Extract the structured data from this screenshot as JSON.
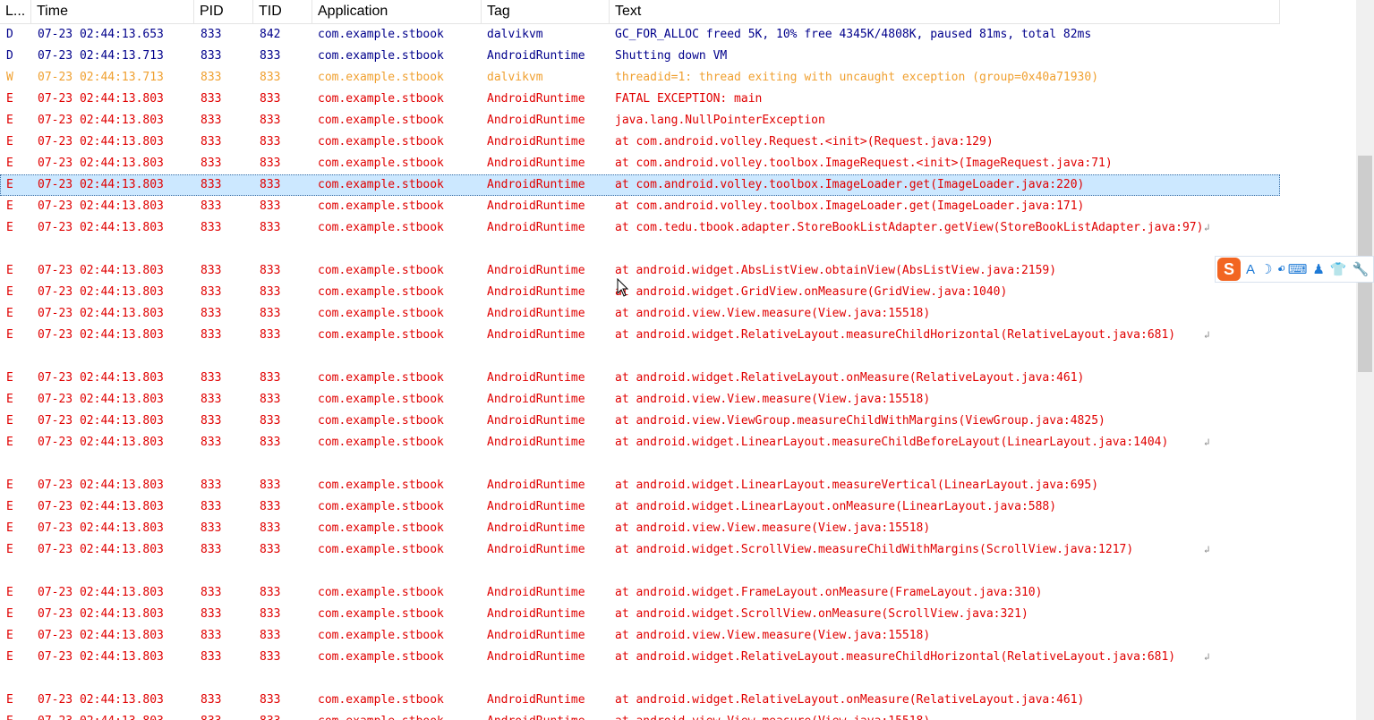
{
  "columns": [
    "L...",
    "Time",
    "PID",
    "TID",
    "Application",
    "Tag",
    "Text"
  ],
  "level_colors": {
    "D": "#00008b",
    "W": "#f0a030",
    "E": "#e00000"
  },
  "selected_row": 7,
  "scrollbar": {
    "position_fraction": 0.27,
    "visible_fraction": 0.3
  },
  "ime_toolbar": {
    "logo": "S",
    "buttons": [
      "A",
      "☽",
      "•ͦ",
      "⌨",
      "♟",
      "👕",
      "🔧"
    ],
    "icons": [
      "sogou-logo-icon",
      "font-a-icon",
      "moon-icon",
      "punctuation-icon",
      "keyboard-icon",
      "user-icon",
      "skin-icon",
      "tools-icon"
    ]
  },
  "rows": [
    {
      "level": "D",
      "time": "07-23 02:44:13.653",
      "pid": "833",
      "tid": "842",
      "app": "com.example.stbook",
      "tag": "dalvikvm",
      "text": "GC_FOR_ALLOC freed 5K, 10% free 4345K/4808K, paused 81ms, total 82ms",
      "wrap": false
    },
    {
      "level": "D",
      "time": "07-23 02:44:13.713",
      "pid": "833",
      "tid": "833",
      "app": "com.example.stbook",
      "tag": "AndroidRuntime",
      "text": "Shutting down VM",
      "wrap": false
    },
    {
      "level": "W",
      "time": "07-23 02:44:13.713",
      "pid": "833",
      "tid": "833",
      "app": "com.example.stbook",
      "tag": "dalvikvm",
      "text": "threadid=1: thread exiting with uncaught exception (group=0x40a71930)",
      "wrap": false
    },
    {
      "level": "E",
      "time": "07-23 02:44:13.803",
      "pid": "833",
      "tid": "833",
      "app": "com.example.stbook",
      "tag": "AndroidRuntime",
      "text": "FATAL EXCEPTION: main",
      "wrap": false
    },
    {
      "level": "E",
      "time": "07-23 02:44:13.803",
      "pid": "833",
      "tid": "833",
      "app": "com.example.stbook",
      "tag": "AndroidRuntime",
      "text": "java.lang.NullPointerException",
      "wrap": false
    },
    {
      "level": "E",
      "time": "07-23 02:44:13.803",
      "pid": "833",
      "tid": "833",
      "app": "com.example.stbook",
      "tag": "AndroidRuntime",
      "text": "at com.android.volley.Request.<init>(Request.java:129)",
      "wrap": false
    },
    {
      "level": "E",
      "time": "07-23 02:44:13.803",
      "pid": "833",
      "tid": "833",
      "app": "com.example.stbook",
      "tag": "AndroidRuntime",
      "text": "at com.android.volley.toolbox.ImageRequest.<init>(ImageRequest.java:71)",
      "wrap": false
    },
    {
      "level": "E",
      "time": "07-23 02:44:13.803",
      "pid": "833",
      "tid": "833",
      "app": "com.example.stbook",
      "tag": "AndroidRuntime",
      "text": "at com.android.volley.toolbox.ImageLoader.get(ImageLoader.java:220)",
      "wrap": false
    },
    {
      "level": "E",
      "time": "07-23 02:44:13.803",
      "pid": "833",
      "tid": "833",
      "app": "com.example.stbook",
      "tag": "AndroidRuntime",
      "text": "at com.android.volley.toolbox.ImageLoader.get(ImageLoader.java:171)",
      "wrap": false
    },
    {
      "level": "E",
      "time": "07-23 02:44:13.803",
      "pid": "833",
      "tid": "833",
      "app": "com.example.stbook",
      "tag": "AndroidRuntime",
      "text": "at com.tedu.tbook.adapter.StoreBookListAdapter.getView(StoreBookListAdapter.java:97)",
      "wrap": true
    },
    {
      "level": "E",
      "time": "07-23 02:44:13.803",
      "pid": "833",
      "tid": "833",
      "app": "com.example.stbook",
      "tag": "AndroidRuntime",
      "text": "at android.widget.AbsListView.obtainView(AbsListView.java:2159)",
      "wrap": false
    },
    {
      "level": "E",
      "time": "07-23 02:44:13.803",
      "pid": "833",
      "tid": "833",
      "app": "com.example.stbook",
      "tag": "AndroidRuntime",
      "text": "at android.widget.GridView.onMeasure(GridView.java:1040)",
      "wrap": false
    },
    {
      "level": "E",
      "time": "07-23 02:44:13.803",
      "pid": "833",
      "tid": "833",
      "app": "com.example.stbook",
      "tag": "AndroidRuntime",
      "text": "at android.view.View.measure(View.java:15518)",
      "wrap": false
    },
    {
      "level": "E",
      "time": "07-23 02:44:13.803",
      "pid": "833",
      "tid": "833",
      "app": "com.example.stbook",
      "tag": "AndroidRuntime",
      "text": "at android.widget.RelativeLayout.measureChildHorizontal(RelativeLayout.java:681)",
      "wrap": true
    },
    {
      "level": "E",
      "time": "07-23 02:44:13.803",
      "pid": "833",
      "tid": "833",
      "app": "com.example.stbook",
      "tag": "AndroidRuntime",
      "text": "at android.widget.RelativeLayout.onMeasure(RelativeLayout.java:461)",
      "wrap": false
    },
    {
      "level": "E",
      "time": "07-23 02:44:13.803",
      "pid": "833",
      "tid": "833",
      "app": "com.example.stbook",
      "tag": "AndroidRuntime",
      "text": "at android.view.View.measure(View.java:15518)",
      "wrap": false
    },
    {
      "level": "E",
      "time": "07-23 02:44:13.803",
      "pid": "833",
      "tid": "833",
      "app": "com.example.stbook",
      "tag": "AndroidRuntime",
      "text": "at android.view.ViewGroup.measureChildWithMargins(ViewGroup.java:4825)",
      "wrap": false
    },
    {
      "level": "E",
      "time": "07-23 02:44:13.803",
      "pid": "833",
      "tid": "833",
      "app": "com.example.stbook",
      "tag": "AndroidRuntime",
      "text": "at android.widget.LinearLayout.measureChildBeforeLayout(LinearLayout.java:1404)",
      "wrap": true
    },
    {
      "level": "E",
      "time": "07-23 02:44:13.803",
      "pid": "833",
      "tid": "833",
      "app": "com.example.stbook",
      "tag": "AndroidRuntime",
      "text": "at android.widget.LinearLayout.measureVertical(LinearLayout.java:695)",
      "wrap": false
    },
    {
      "level": "E",
      "time": "07-23 02:44:13.803",
      "pid": "833",
      "tid": "833",
      "app": "com.example.stbook",
      "tag": "AndroidRuntime",
      "text": "at android.widget.LinearLayout.onMeasure(LinearLayout.java:588)",
      "wrap": false
    },
    {
      "level": "E",
      "time": "07-23 02:44:13.803",
      "pid": "833",
      "tid": "833",
      "app": "com.example.stbook",
      "tag": "AndroidRuntime",
      "text": "at android.view.View.measure(View.java:15518)",
      "wrap": false
    },
    {
      "level": "E",
      "time": "07-23 02:44:13.803",
      "pid": "833",
      "tid": "833",
      "app": "com.example.stbook",
      "tag": "AndroidRuntime",
      "text": "at android.widget.ScrollView.measureChildWithMargins(ScrollView.java:1217)",
      "wrap": true
    },
    {
      "level": "E",
      "time": "07-23 02:44:13.803",
      "pid": "833",
      "tid": "833",
      "app": "com.example.stbook",
      "tag": "AndroidRuntime",
      "text": "at android.widget.FrameLayout.onMeasure(FrameLayout.java:310)",
      "wrap": false
    },
    {
      "level": "E",
      "time": "07-23 02:44:13.803",
      "pid": "833",
      "tid": "833",
      "app": "com.example.stbook",
      "tag": "AndroidRuntime",
      "text": "at android.widget.ScrollView.onMeasure(ScrollView.java:321)",
      "wrap": false
    },
    {
      "level": "E",
      "time": "07-23 02:44:13.803",
      "pid": "833",
      "tid": "833",
      "app": "com.example.stbook",
      "tag": "AndroidRuntime",
      "text": "at android.view.View.measure(View.java:15518)",
      "wrap": false
    },
    {
      "level": "E",
      "time": "07-23 02:44:13.803",
      "pid": "833",
      "tid": "833",
      "app": "com.example.stbook",
      "tag": "AndroidRuntime",
      "text": "at android.widget.RelativeLayout.measureChildHorizontal(RelativeLayout.java:681)",
      "wrap": true
    },
    {
      "level": "E",
      "time": "07-23 02:44:13.803",
      "pid": "833",
      "tid": "833",
      "app": "com.example.stbook",
      "tag": "AndroidRuntime",
      "text": "at android.widget.RelativeLayout.onMeasure(RelativeLayout.java:461)",
      "wrap": false
    },
    {
      "level": "E",
      "time": "07-23 02:44:13.803",
      "pid": "833",
      "tid": "833",
      "app": "com.example.stbook",
      "tag": "AndroidRuntime",
      "text": "at android.view.View.measure(View.java:15518)",
      "wrap": false
    }
  ]
}
